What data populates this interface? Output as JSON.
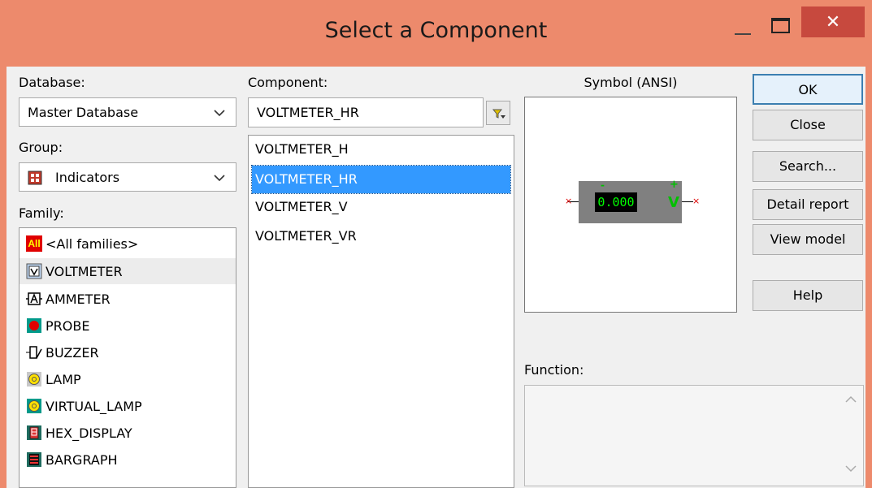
{
  "window": {
    "title": "Select a Component",
    "close_glyph": "✕"
  },
  "database": {
    "label": "Database:",
    "value": "Master Database"
  },
  "group": {
    "label": "Group:",
    "value": "Indicators",
    "icon": "indicators-group-icon"
  },
  "family": {
    "label": "Family:",
    "items": [
      {
        "label": "<All families>",
        "icon": "all-families-icon",
        "icon_text": "All"
      },
      {
        "label": "VOLTMETER",
        "icon": "voltmeter-icon"
      },
      {
        "label": "AMMETER",
        "icon": "ammeter-icon"
      },
      {
        "label": "PROBE",
        "icon": "probe-icon"
      },
      {
        "label": "BUZZER",
        "icon": "buzzer-icon"
      },
      {
        "label": "LAMP",
        "icon": "lamp-icon"
      },
      {
        "label": "VIRTUAL_LAMP",
        "icon": "virtual-lamp-icon"
      },
      {
        "label": "HEX_DISPLAY",
        "icon": "hex-display-icon"
      },
      {
        "label": "BARGRAPH",
        "icon": "bargraph-icon"
      }
    ],
    "selected": "VOLTMETER"
  },
  "component": {
    "label": "Component:",
    "value": "VOLTMETER_HR",
    "items": [
      "VOLTMETER_H",
      "VOLTMETER_HR",
      "VOLTMETER_V",
      "VOLTMETER_VR"
    ],
    "selected": "VOLTMETER_HR"
  },
  "symbol": {
    "label": "Symbol (ANSI)",
    "display_value": "0.000",
    "unit": "V",
    "plus": "+",
    "minus": "-"
  },
  "function": {
    "label": "Function:",
    "value": ""
  },
  "buttons": {
    "ok": "OK",
    "close": "Close",
    "search": "Search...",
    "detail_report": "Detail report",
    "view_model": "View model",
    "help": "Help"
  },
  "colors": {
    "title_bar": "#ed8a6c",
    "close_button": "#c7493e",
    "selection": "#3399ff",
    "meter_body": "#808080",
    "meter_display_text": "#00ff00"
  }
}
